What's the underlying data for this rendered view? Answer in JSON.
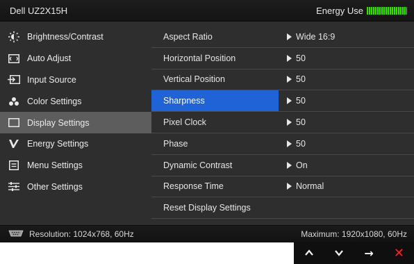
{
  "header": {
    "model": "Dell UZ2X15H",
    "energy_label": "Energy Use"
  },
  "menu": [
    {
      "label": "Brightness/Contrast",
      "icon": "brightness-icon"
    },
    {
      "label": "Auto Adjust",
      "icon": "auto-adjust-icon"
    },
    {
      "label": "Input Source",
      "icon": "input-source-icon"
    },
    {
      "label": "Color Settings",
      "icon": "color-settings-icon"
    },
    {
      "label": "Display Settings",
      "icon": "display-settings-icon"
    },
    {
      "label": "Energy Settings",
      "icon": "energy-settings-icon"
    },
    {
      "label": "Menu Settings",
      "icon": "menu-settings-icon"
    },
    {
      "label": "Other Settings",
      "icon": "other-settings-icon"
    }
  ],
  "active_menu": "Display Settings",
  "settings": [
    {
      "name": "Aspect Ratio",
      "value": "Wide 16:9"
    },
    {
      "name": "Horizontal Position",
      "value": "50"
    },
    {
      "name": "Vertical Position",
      "value": "50"
    },
    {
      "name": "Sharpness",
      "value": "50"
    },
    {
      "name": "Pixel Clock",
      "value": "50"
    },
    {
      "name": "Phase",
      "value": "50"
    },
    {
      "name": "Dynamic Contrast",
      "value": "On"
    },
    {
      "name": "Response Time",
      "value": "Normal"
    },
    {
      "name": "Reset Display Settings",
      "value": ""
    }
  ],
  "highlighted_setting": "Sharpness",
  "status": {
    "resolution": "Resolution: 1024x768, 60Hz",
    "maximum": "Maximum: 1920x1080, 60Hz"
  },
  "nav": {
    "up": "^",
    "down": "v",
    "right": "→",
    "close": "✕"
  },
  "colors": {
    "highlight": "#1f63d6",
    "energy_bar": "#36e000",
    "close": "#ff2020"
  }
}
